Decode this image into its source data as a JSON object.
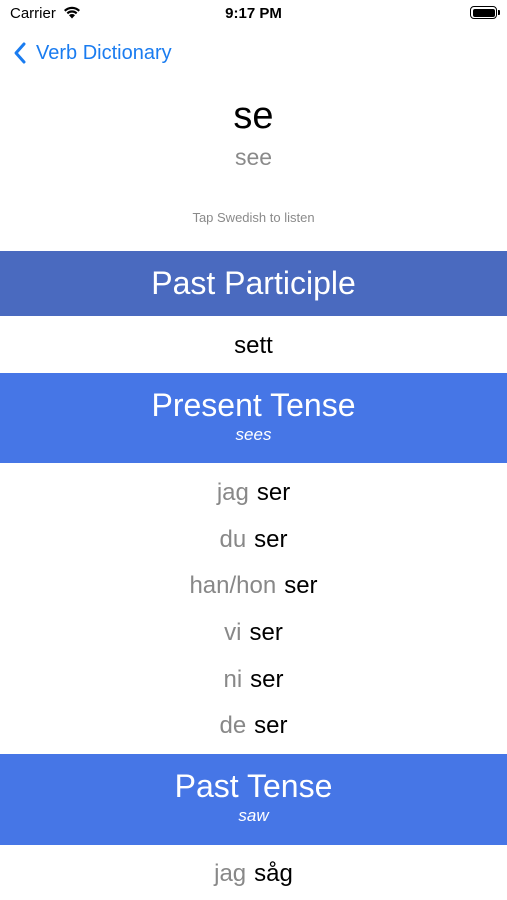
{
  "status_bar": {
    "carrier": "Carrier",
    "time": "9:17 PM"
  },
  "nav": {
    "back_label": "Verb Dictionary"
  },
  "verb": {
    "swedish": "se",
    "english": "see"
  },
  "hint": "Tap Swedish to listen",
  "past_participle": {
    "title": "Past Participle",
    "form": "sett"
  },
  "present_tense": {
    "title": "Present Tense",
    "english": "sees",
    "rows": [
      {
        "pronoun": "jag",
        "form": "ser"
      },
      {
        "pronoun": "du",
        "form": "ser"
      },
      {
        "pronoun": "han/hon",
        "form": "ser"
      },
      {
        "pronoun": "vi",
        "form": "ser"
      },
      {
        "pronoun": "ni",
        "form": "ser"
      },
      {
        "pronoun": "de",
        "form": "ser"
      }
    ]
  },
  "past_tense": {
    "title": "Past Tense",
    "english": "saw",
    "rows": [
      {
        "pronoun": "jag",
        "form": "såg"
      }
    ]
  }
}
